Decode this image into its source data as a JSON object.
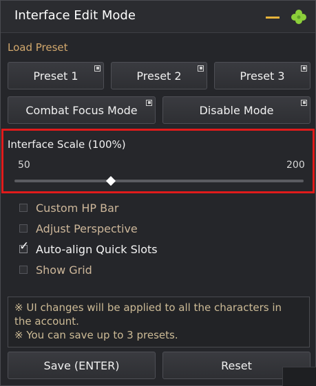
{
  "window": {
    "title": "Interface Edit Mode"
  },
  "load_preset": {
    "label": "Load Preset",
    "presets": [
      {
        "label": "Preset 1"
      },
      {
        "label": "Preset 2"
      },
      {
        "label": "Preset 3"
      }
    ],
    "modes": [
      {
        "label": "Combat Focus Mode"
      },
      {
        "label": "Disable Mode"
      }
    ]
  },
  "scale": {
    "label": "Interface Scale (100%)",
    "min_label": "50",
    "max_label": "200",
    "min": 50,
    "max": 200,
    "value": 100
  },
  "options": [
    {
      "label": "Custom HP Bar",
      "checked": false
    },
    {
      "label": "Adjust Perspective",
      "checked": false
    },
    {
      "label": "Auto-align Quick Slots",
      "checked": true
    },
    {
      "label": "Show Grid",
      "checked": false
    }
  ],
  "notice": {
    "lines": [
      "※ UI changes will be applied to all the characters in",
      "the account.",
      "※ You can save up to 3 presets."
    ]
  },
  "footer": {
    "save_label": "Save (ENTER)",
    "reset_label": "Reset"
  },
  "colors": {
    "highlight_border": "#e11b1b",
    "section_label": "#d2a86d",
    "minimize_accent": "#e7b43b",
    "clover": "#8ccf3a"
  },
  "icons": {
    "minimize": "minimize-icon",
    "clover": "clover-icon",
    "corner": "popout-corner-icon",
    "checkmark": "checkmark-icon"
  }
}
